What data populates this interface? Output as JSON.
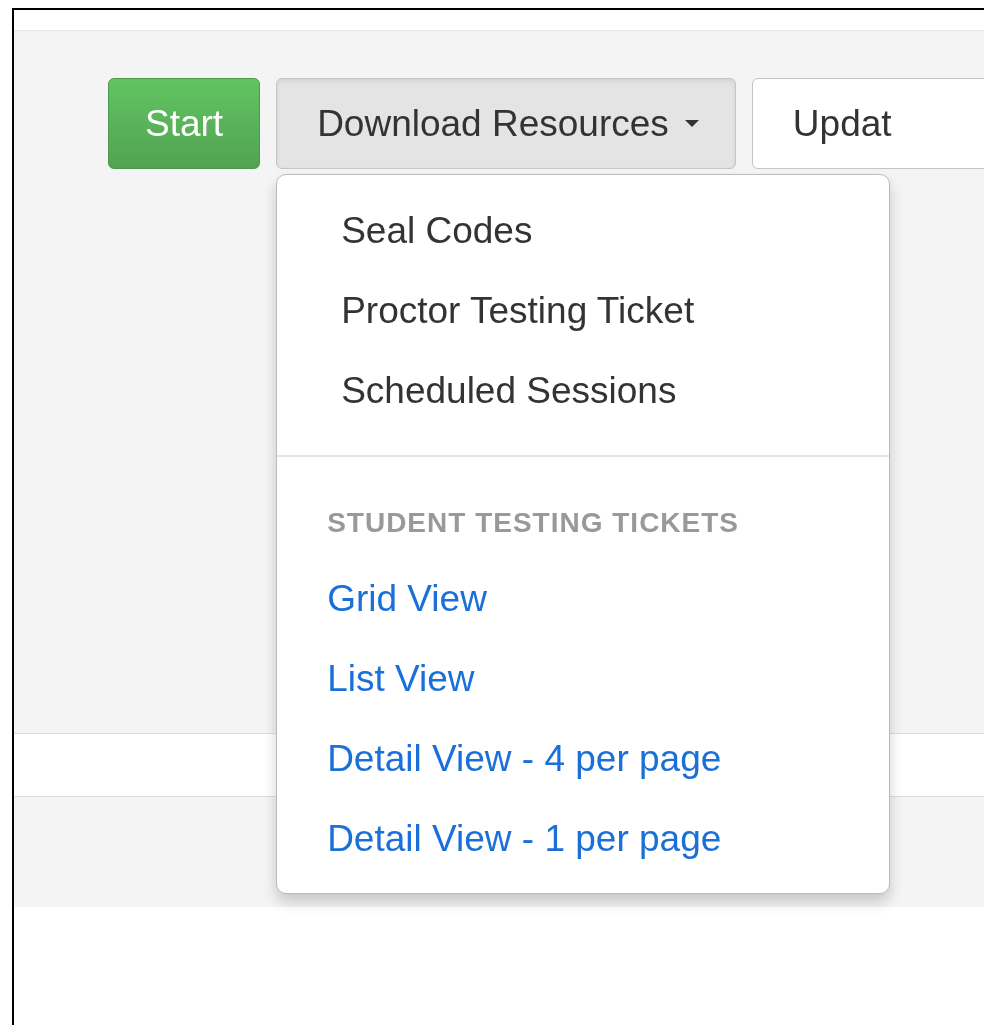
{
  "toolbar": {
    "buttons": [
      {
        "label": "Start",
        "kind": "success"
      },
      {
        "label": "Download Resources",
        "kind": "dropdown",
        "expanded": true
      },
      {
        "label": "Updat",
        "kind": "default"
      }
    ]
  },
  "dropdown_menu": {
    "items": [
      {
        "kind": "item",
        "label": "Seal Codes"
      },
      {
        "kind": "item",
        "label": "Proctor Testing Ticket"
      },
      {
        "kind": "item",
        "label": "Scheduled Sessions"
      },
      {
        "kind": "divider"
      },
      {
        "kind": "header",
        "label": "STUDENT TESTING TICKETS"
      },
      {
        "kind": "link",
        "label": "Grid View"
      },
      {
        "kind": "link",
        "label": "List View"
      },
      {
        "kind": "link",
        "label": "Detail View - 4 per page"
      },
      {
        "kind": "link",
        "label": "Detail View - 1 per page"
      }
    ]
  }
}
